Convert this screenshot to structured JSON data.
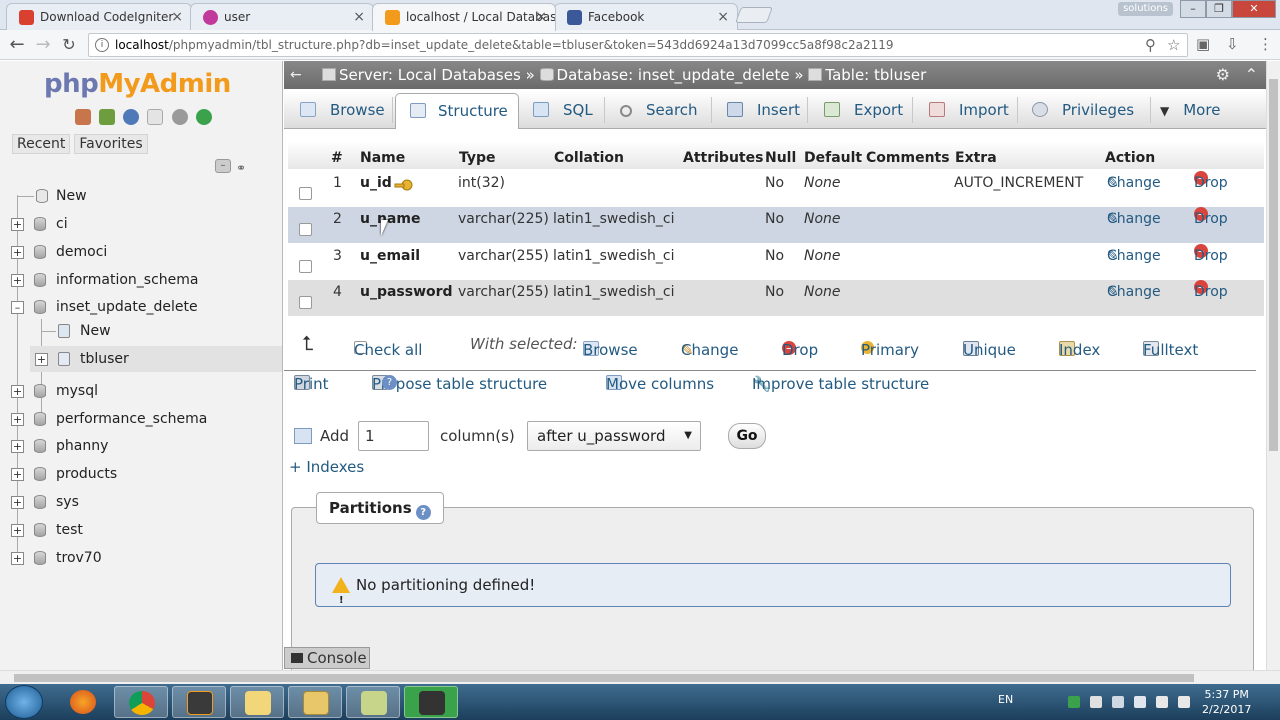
{
  "browser": {
    "tabs": [
      {
        "title": "Download CodeIgniter",
        "active": false
      },
      {
        "title": "user",
        "active": false
      },
      {
        "title": "localhost / Local Databas",
        "active": true
      },
      {
        "title": "Facebook",
        "active": false
      }
    ],
    "profile_label": "solutions",
    "url_host": "localhost",
    "url_rest": "/phpmyadmin/tbl_structure.php?db=inset_update_delete&table=tbluser&token=543dd6924a13d7099cc5a8f98c2a2119"
  },
  "sidebar": {
    "logo_php": "php",
    "logo_my": "MyAdmin",
    "recent_label": "Recent",
    "favorites_label": "Favorites",
    "items": [
      {
        "label": "New"
      },
      {
        "label": "ci"
      },
      {
        "label": "democi"
      },
      {
        "label": "information_schema"
      },
      {
        "label": "inset_update_delete"
      },
      {
        "label": "New"
      },
      {
        "label": "tbluser"
      },
      {
        "label": "mysql"
      },
      {
        "label": "performance_schema"
      },
      {
        "label": "phanny"
      },
      {
        "label": "products"
      },
      {
        "label": "sys"
      },
      {
        "label": "test"
      },
      {
        "label": "trov70"
      }
    ]
  },
  "breadcrumb": {
    "server": "Server: Local Databases",
    "sep1": "»",
    "database": "Database: inset_update_delete",
    "sep2": "»",
    "table": "Table: tbluser"
  },
  "tabs": [
    {
      "label": "Browse"
    },
    {
      "label": "Structure"
    },
    {
      "label": "SQL"
    },
    {
      "label": "Search"
    },
    {
      "label": "Insert"
    },
    {
      "label": "Export"
    },
    {
      "label": "Import"
    },
    {
      "label": "Privileges"
    },
    {
      "label": "More"
    }
  ],
  "structure": {
    "headers": {
      "num": "#",
      "name": "Name",
      "type": "Type",
      "collation": "Collation",
      "attributes": "Attributes",
      "null": "Null",
      "default": "Default",
      "comments": "Comments",
      "extra": "Extra",
      "action": "Action"
    },
    "rows": [
      {
        "num": "1",
        "name": "u_id",
        "type": "int(32)",
        "collation": "",
        "null": "No",
        "default": "None",
        "extra": "AUTO_INCREMENT",
        "change": "Change",
        "drop": "Drop"
      },
      {
        "num": "2",
        "name": "u_name",
        "type": "varchar(225)",
        "collation": "latin1_swedish_ci",
        "null": "No",
        "default": "None",
        "extra": "",
        "change": "Change",
        "drop": "Drop"
      },
      {
        "num": "3",
        "name": "u_email",
        "type": "varchar(255)",
        "collation": "latin1_swedish_ci",
        "null": "No",
        "default": "None",
        "extra": "",
        "change": "Change",
        "drop": "Drop"
      },
      {
        "num": "4",
        "name": "u_password",
        "type": "varchar(255)",
        "collation": "latin1_swedish_ci",
        "null": "No",
        "default": "None",
        "extra": "",
        "change": "Change",
        "drop": "Drop"
      }
    ]
  },
  "with_selected": {
    "check_all": "Check all",
    "label": "With selected:",
    "actions": [
      "Browse",
      "Change",
      "Drop",
      "Primary",
      "Unique",
      "Index",
      "Fulltext"
    ]
  },
  "tools": {
    "print": "Print",
    "propose": "Propose table structure",
    "move": "Move columns",
    "improve": "Improve table structure"
  },
  "add_columns": {
    "add_label": "Add",
    "count": "1",
    "columns_label": "column(s)",
    "position": "after u_password",
    "go": "Go"
  },
  "indexes_link": "+ Indexes",
  "partitions": {
    "legend": "Partitions",
    "notice": "No partitioning defined!"
  },
  "console_label": "Console",
  "taskbar": {
    "lang": "EN",
    "time": "5:37 PM",
    "date": "2/2/2017"
  }
}
